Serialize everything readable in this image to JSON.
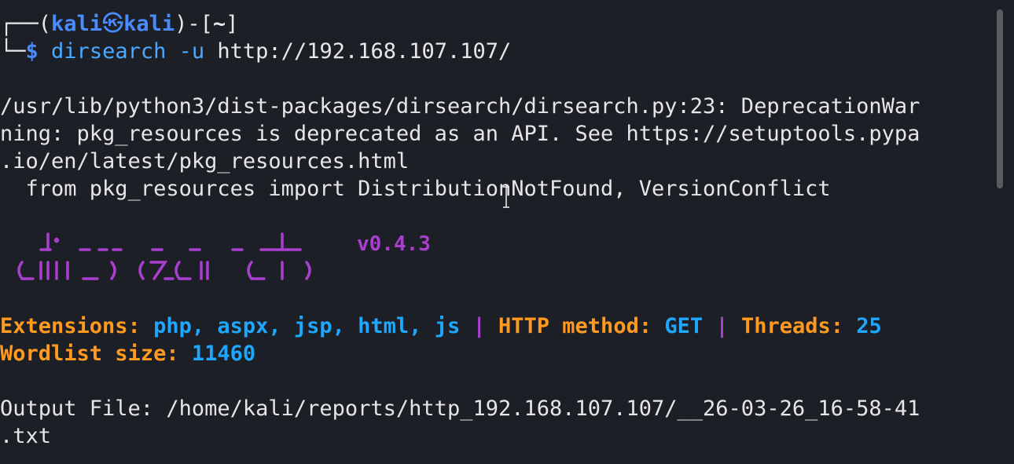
{
  "prompt": {
    "corner_top": "┌──(",
    "user": "kali",
    "at_symbol": "㉿",
    "host": "kali",
    "close": ")-[",
    "dir": "~",
    "close2": "]",
    "corner_bottom": "└─",
    "dollar": "$",
    "command": "dirsearch",
    "flag": "-u",
    "url": "http://192.168.107.107/"
  },
  "warning": {
    "line1": "/usr/lib/python3/dist-packages/dirsearch/dirsearch.py:23: DeprecationWar",
    "line2": "ning: pkg_resources is deprecated as an API. See https://setuptools.pypa",
    "line3": ".io/en/latest/pkg_resources.html",
    "line4": "  from pkg_resources import DistributionNotFound, VersionConflict"
  },
  "banner": {
    "version": "v0.4.3"
  },
  "config": {
    "extensions_label": "Extensions:",
    "extensions_value": "php, aspx, jsp, html, js",
    "sep1": "|",
    "method_label": "HTTP method:",
    "method_value": "GET",
    "sep2": "|",
    "threads_label": "Threads:",
    "threads_value": "25",
    "wordlist_label": "Wordlist size:",
    "wordlist_value": "11460"
  },
  "output": {
    "line1": "Output File: /home/kali/reports/http_192.168.107.107/__26-03-26_16-58-41",
    "line2": ".txt"
  },
  "colors": {
    "background": "#1d1f26",
    "orange": "#ff9a1f",
    "cyan": "#1ea7ff",
    "purple": "#a93fcf"
  }
}
